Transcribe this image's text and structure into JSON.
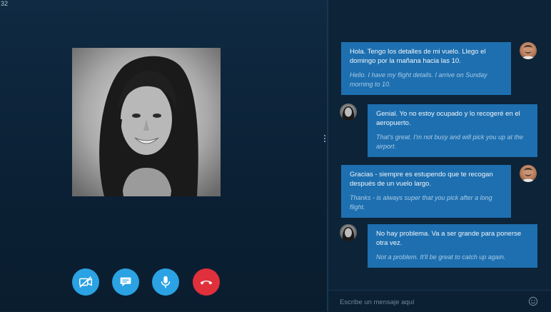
{
  "call": {
    "timer": "32",
    "controls": {
      "video": {
        "icon": "video-off-icon"
      },
      "chat": {
        "icon": "chat-icon"
      },
      "mic": {
        "icon": "microphone-icon"
      },
      "end": {
        "icon": "hang-up-icon"
      }
    }
  },
  "chat": {
    "messages": [
      {
        "sender": "self",
        "original": "Hola. Tengo los detalles de mi vuelo. Llego el domingo por la mañana hacia las 10.",
        "translation": "Hello. I have my flight details. I arrive on Sunday morning to 10."
      },
      {
        "sender": "contact",
        "original": "Genial. Yo no estoy ocupado y lo recogeré en el aeropuerto.",
        "translation": "That's great. I'm not busy and will pick you up at the airport."
      },
      {
        "sender": "self",
        "original": "Gracias - siempre es estupendo que te recogan después de un vuelo largo.",
        "translation": "Thanks - is always super that you pick after a long flight."
      },
      {
        "sender": "contact",
        "original": "No hay problema. Va a ser grande para ponerse otra vez.",
        "translation": "Not a problem. It'll be great to catch up again."
      }
    ],
    "composer": {
      "placeholder": "Escribe un mensaje aquí"
    }
  },
  "colors": {
    "accent": "#2aa2e3",
    "end_call": "#e0303c",
    "bubble": "#1d6fb0",
    "background": "#0c2236"
  }
}
